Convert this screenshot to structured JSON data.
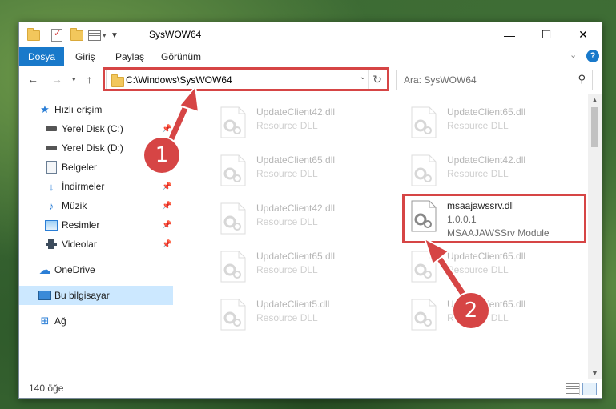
{
  "window": {
    "title": "SysWOW64",
    "minimize": "—",
    "maximize": "☐",
    "close": "✕"
  },
  "ribbon": {
    "tabs": [
      "Dosya",
      "Giriş",
      "Paylaş",
      "Görünüm"
    ],
    "help": "?"
  },
  "nav": {
    "address": "C:\\Windows\\SysWOW64",
    "search_placeholder": "Ara: SysWOW64"
  },
  "sidebar": {
    "items": [
      {
        "label": "Hızlı erişim",
        "icon": "star-icon",
        "pinned": false
      },
      {
        "label": "Yerel Disk (C:)",
        "icon": "drive-icon",
        "pinned": true
      },
      {
        "label": "Yerel Disk (D:)",
        "icon": "drive-icon",
        "pinned": true
      },
      {
        "label": "Belgeler",
        "icon": "documents-icon",
        "pinned": true
      },
      {
        "label": "İndirmeler",
        "icon": "download-icon",
        "pinned": true
      },
      {
        "label": "Müzik",
        "icon": "music-icon",
        "pinned": true
      },
      {
        "label": "Resimler",
        "icon": "pictures-icon",
        "pinned": true
      },
      {
        "label": "Videolar",
        "icon": "video-icon",
        "pinned": true
      },
      {
        "label": "OneDrive",
        "icon": "cloud-icon",
        "pinned": false
      },
      {
        "label": "Bu bilgisayar",
        "icon": "computer-icon",
        "pinned": false,
        "selected": true
      },
      {
        "label": "Ağ",
        "icon": "network-icon",
        "pinned": false
      }
    ]
  },
  "files": {
    "left": [
      {
        "name": "UpdateClient42.dll",
        "type": "Resource DLL"
      },
      {
        "name": "UpdateClient65.dll",
        "type": "Resource DLL"
      },
      {
        "name": "UpdateClient42.dll",
        "type": "Resource DLL"
      },
      {
        "name": "UpdateClient65.dll",
        "type": "Resource DLL"
      },
      {
        "name": "UpdateClient5.dll",
        "type": "Resource DLL"
      }
    ],
    "right": [
      {
        "name": "UpdateClient65.dll",
        "type": "Resource DLL"
      },
      {
        "name": "UpdateClient42.dll",
        "type": "Resource DLL"
      },
      {
        "name": "UpdateClient65.dll",
        "type": "Resource DLL"
      },
      {
        "name": "UpdateClient65.dll",
        "type": "Resource DLL"
      }
    ],
    "highlighted": {
      "name": "msaajawssrv.dll",
      "version": "1.0.0.1",
      "description": "MSAAJAWSSrv Module"
    }
  },
  "status": {
    "count": "140 öğe"
  },
  "callouts": {
    "one": "1",
    "two": "2"
  },
  "colors": {
    "accent": "#1979ca",
    "highlight": "#d64545",
    "selected": "#cce8ff"
  }
}
